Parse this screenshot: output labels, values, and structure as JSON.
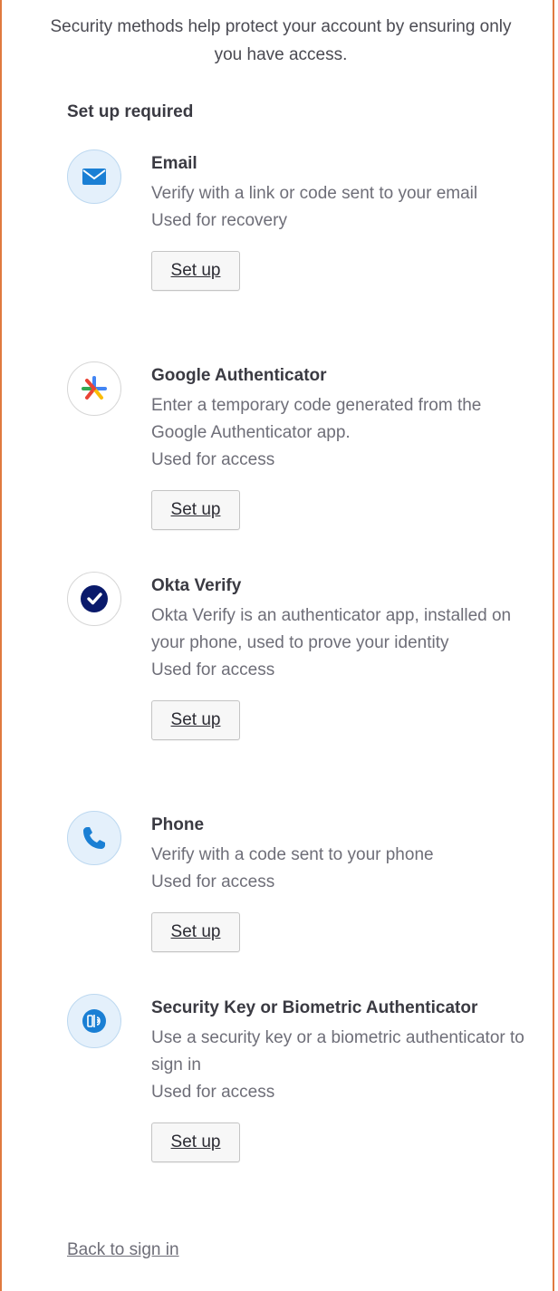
{
  "intro": "Security methods help protect your account by ensuring only you have access.",
  "section_title": "Set up required",
  "methods": [
    {
      "title": "Email",
      "description": "Verify with a link or code sent to your email",
      "usage": "Used for recovery",
      "button": "Set up",
      "icon": "email-icon"
    },
    {
      "title": "Google Authenticator",
      "description": "Enter a temporary code generated from the Google Authenticator app.",
      "usage": "Used for access",
      "button": "Set up",
      "icon": "google-authenticator-icon"
    },
    {
      "title": "Okta Verify",
      "description": "Okta Verify is an authenticator app, installed on your phone, used to prove your identity",
      "usage": "Used for access",
      "button": "Set up",
      "icon": "okta-verify-icon"
    },
    {
      "title": "Phone",
      "description": "Verify with a code sent to your phone",
      "usage": "Used for access",
      "button": "Set up",
      "icon": "phone-icon"
    },
    {
      "title": "Security Key or Biometric Authenticator",
      "description": "Use a security key or a biometric authenticator to sign in",
      "usage": "Used for access",
      "button": "Set up",
      "icon": "security-key-icon"
    }
  ],
  "back_link": "Back to sign in",
  "colors": {
    "frame_border": "#e07a3f",
    "icon_blue": "#1a7fd4",
    "okta_navy": "#0a1a6b"
  }
}
